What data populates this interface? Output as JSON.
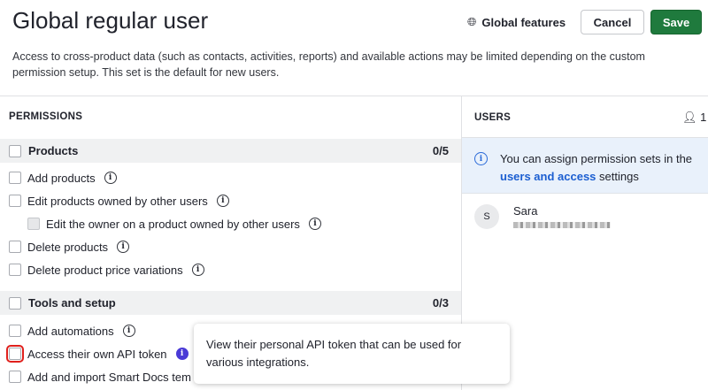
{
  "header": {
    "title": "Global regular user",
    "global_features": "Global features",
    "cancel": "Cancel",
    "save": "Save",
    "description": "Access to cross-product data (such as contacts, activities, reports) and available actions may be limited depending on the custom permission setup. This set is the default for new users."
  },
  "permissions": {
    "heading": "PERMISSIONS",
    "groups": [
      {
        "name": "Products",
        "count": "0/5",
        "items": [
          "Add products",
          "Edit products owned by other users",
          "Edit the owner on a product owned by other users",
          "Delete products",
          "Delete product price variations"
        ]
      },
      {
        "name": "Tools and setup",
        "count": "0/3",
        "items": [
          "Add automations",
          "Access their own API token",
          "Add and import Smart Docs tem"
        ]
      }
    ]
  },
  "tooltip": "View their personal API token that can be used for various integrations.",
  "users": {
    "heading": "USERS",
    "count": "1",
    "banner_text": "You can assign permission sets in the",
    "banner_link": "users and access",
    "banner_suffix": " settings",
    "list": [
      {
        "initial": "S",
        "name": "Sara"
      }
    ]
  }
}
